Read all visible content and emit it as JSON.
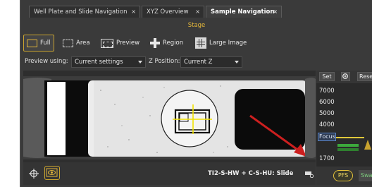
{
  "tabs": [
    {
      "label": "Well Plate and Slide Navigation",
      "close": "×",
      "active": false
    },
    {
      "label": "XYZ Overview",
      "close": "×",
      "active": false
    },
    {
      "label": "Sample Navigation",
      "close": "×",
      "active": true
    }
  ],
  "stage": {
    "title": "Stage"
  },
  "toolbar": {
    "full": "Full",
    "area": "Area",
    "preview": "Preview",
    "region": "Region",
    "large_image": "Large Image"
  },
  "preview_row": {
    "preview_using_label": "Preview using:",
    "preview_using_value": "Current settings",
    "z_position_label": "Z Position:",
    "z_position_value": "Current Z"
  },
  "status": {
    "text": "TI2-S-HW + C-S-HU: Slide"
  },
  "z_panel": {
    "set_label": "Set",
    "reset_label": "Reset",
    "ticks": [
      "7000",
      "6000",
      "5000",
      "4000",
      "1700"
    ],
    "focus_label": "Focus",
    "pfs_label": "PFS",
    "swap_label": "Swap"
  },
  "colors": {
    "accent": "#e0b43a",
    "panel_bg": "#3a3a3a",
    "arrow": "#cc1f1f",
    "crosshair": "#f2e200",
    "pfs_green": "#3ca83c"
  }
}
